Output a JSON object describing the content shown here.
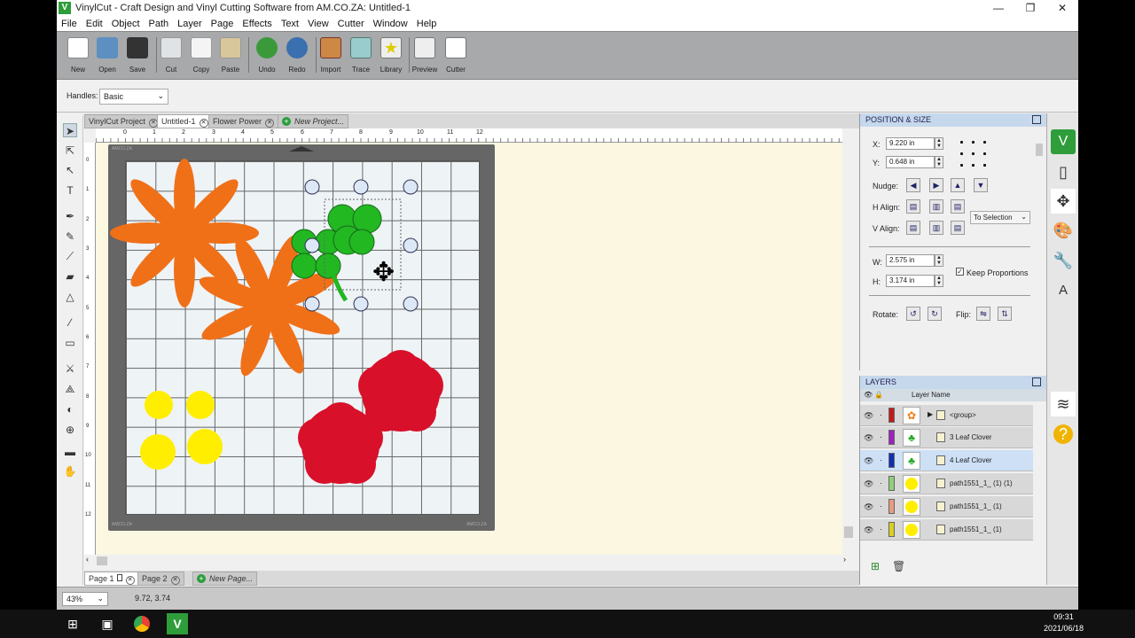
{
  "window": {
    "title": "VinylCut - Craft Design and Vinyl Cutting Software from AM.CO.ZA: Untitled-1",
    "min": "—",
    "max": "❐",
    "close": "✕"
  },
  "menu": [
    "File",
    "Edit",
    "Object",
    "Path",
    "Layer",
    "Page",
    "Effects",
    "Text",
    "View",
    "Cutter",
    "Window",
    "Help"
  ],
  "toolbar": [
    {
      "label": "New",
      "color": "#5ba1d6"
    },
    {
      "label": "Open",
      "color": "#5d8fc0"
    },
    {
      "label": "Save",
      "color": "#333"
    },
    {
      "label": "Cut",
      "color": "#9aa"
    },
    {
      "label": "Copy",
      "color": "#ddd"
    },
    {
      "label": "Paste",
      "color": "#d8c79a"
    },
    {
      "label": "Undo",
      "color": "#3a9a3a"
    },
    {
      "label": "Redo",
      "color": "#3a6fb0"
    },
    {
      "label": "Import",
      "color": "#c84"
    },
    {
      "label": "Trace",
      "color": "#6a9"
    },
    {
      "label": "Library",
      "color": "#dd4"
    },
    {
      "label": "Preview",
      "color": "#ccc"
    },
    {
      "label": "Cutter",
      "color": "#eee"
    }
  ],
  "handles": {
    "label": "Handles:",
    "value": "Basic"
  },
  "doc_tabs": [
    {
      "label": "VinylCut Project"
    },
    {
      "label": "Untitled-1"
    },
    {
      "label": "Flower Power"
    },
    {
      "label": "New Project..."
    }
  ],
  "page_tabs": [
    {
      "label": "Page 1"
    },
    {
      "label": "Page 2"
    },
    {
      "label": "New Page..."
    }
  ],
  "ruler_h": [
    "0",
    "1",
    "2",
    "3",
    "4",
    "5",
    "6",
    "7",
    "8",
    "9",
    "10",
    "11",
    "12"
  ],
  "ruler_v": [
    "0",
    "1",
    "2",
    "3",
    "4",
    "5",
    "6",
    "7",
    "8",
    "9",
    "10",
    "11",
    "12"
  ],
  "mat": {
    "brand": "AMCO.ZA"
  },
  "status": {
    "zoom": "43%",
    "coords": "9.72, 3.74"
  },
  "position": {
    "title": "POSITION & SIZE",
    "x_label": "X:",
    "x": "9.220 in",
    "y_label": "Y:",
    "y": "0.648 in",
    "nudge": "Nudge:",
    "halign": "H Align:",
    "valign": "V Align:",
    "align_to": "To Selection",
    "w_label": "W:",
    "w": "2.575 in",
    "h_label": "H:",
    "h": "3.174 in",
    "keep": "Keep Proportions",
    "rotate": "Rotate:",
    "flip": "Flip:"
  },
  "layers": {
    "title": "LAYERS",
    "col": "Layer Name",
    "rows": [
      {
        "name": "<group>",
        "color": "#c21a1a",
        "thumb": "#f07d14",
        "selected": false
      },
      {
        "name": "3 Leaf Clover",
        "color": "#a020c0",
        "thumb": "#22aa22",
        "selected": false
      },
      {
        "name": "4 Leaf Clover",
        "color": "#1030b0",
        "thumb": "#22aa22",
        "selected": true
      },
      {
        "name": "path1551_1_ (1) (1)",
        "color": "#8fcf7a",
        "thumb": "#ffee00",
        "selected": false
      },
      {
        "name": "path1551_1_ (1)",
        "color": "#e89a80",
        "thumb": "#ffee00",
        "selected": false
      },
      {
        "name": "path1551_1_ (1)",
        "color": "#d8d020",
        "thumb": "#ffee00",
        "selected": false
      }
    ]
  },
  "clock": {
    "time": "09:31",
    "date": "2021/06/18"
  },
  "colors": {
    "orange": "#f07018",
    "green": "#22b822",
    "red": "#d8102a",
    "yellow": "#ffee00"
  }
}
